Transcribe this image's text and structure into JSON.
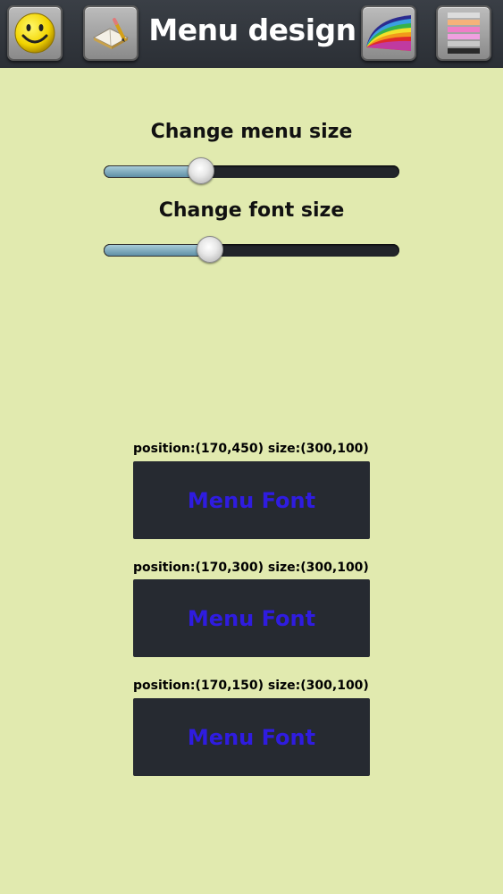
{
  "header": {
    "title": "Menu design",
    "icons": [
      "smiley-icon",
      "book-pencil-icon",
      "rainbow-icon",
      "color-stripes-icon"
    ]
  },
  "sliders": [
    {
      "label": "Change menu size",
      "value_percent": 33
    },
    {
      "label": "Change font size",
      "value_percent": 36
    }
  ],
  "menu_items": [
    {
      "position_text": "position:(170,450) size:(300,100)",
      "label": "Menu Font"
    },
    {
      "position_text": "position:(170,300) size:(300,100)",
      "label": "Menu Font"
    },
    {
      "position_text": "position:(170,150) size:(300,100)",
      "label": "Menu Font"
    }
  ],
  "colors": {
    "background": "#e1eaaf",
    "menu_button_bg": "#262a31",
    "menu_font": "#2f1ce0",
    "slider_fill": "#7fa8bc"
  }
}
